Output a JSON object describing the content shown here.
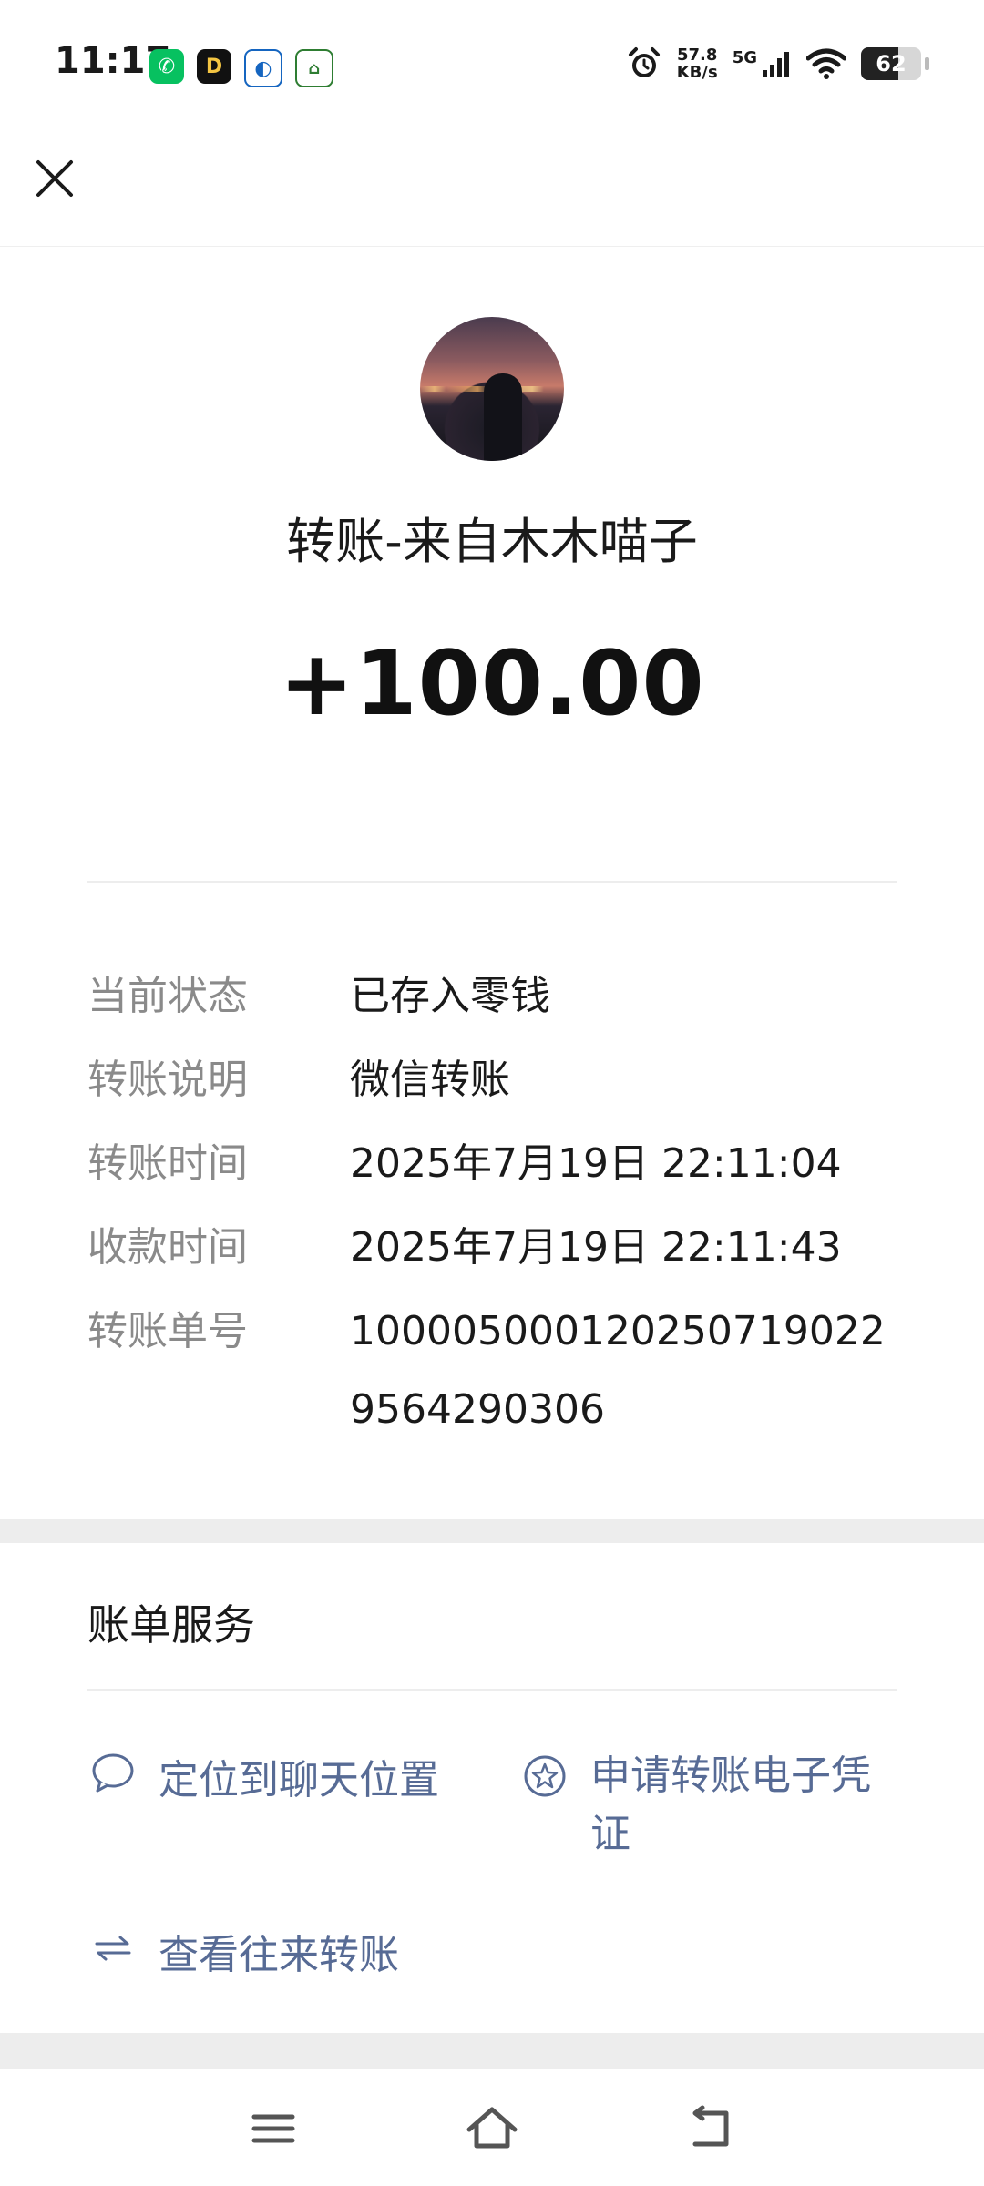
{
  "status_bar": {
    "time": "11:17",
    "net_speed_value": "57.8",
    "net_speed_unit": "KB/s",
    "network": "5G",
    "battery": "62",
    "battery_level": 0.62
  },
  "header": {
    "close_icon": "close-icon"
  },
  "transfer": {
    "title": "转账-来自木木喵子",
    "amount": "+100.00"
  },
  "details": [
    {
      "label": "当前状态",
      "value": "已存入零钱"
    },
    {
      "label": "转账说明",
      "value": "微信转账"
    },
    {
      "label": "转账时间",
      "value": "2025年7月19日 22:11:04"
    },
    {
      "label": "收款时间",
      "value": "2025年7月19日 22:11:43"
    },
    {
      "label": "转账单号",
      "value": "1000050001202507190229564290306"
    }
  ],
  "bill_services": {
    "title": "账单服务",
    "items": [
      {
        "label": "定位到聊天位置",
        "icon": "chat-bubble-icon"
      },
      {
        "label": "申请转账电子凭证",
        "icon": "star-badge-icon"
      },
      {
        "label": "查看往来转账",
        "icon": "swap-arrows-icon"
      }
    ]
  },
  "colors": {
    "link": "#576b95",
    "label": "#8a8a8a",
    "section_bg": "#ededed"
  }
}
